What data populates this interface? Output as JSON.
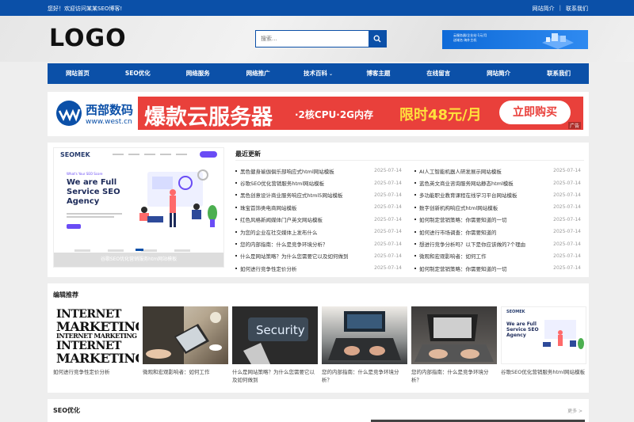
{
  "topbar": {
    "welcome": "您好！欢迎访问某某SEO博客!",
    "links": [
      "网站简介",
      "联系我们"
    ],
    "separator": "|"
  },
  "header": {
    "logo": "LOGO",
    "search_placeholder": "搜索...",
    "banner_lines": [
      "云服务器/企业站·1元/月",
      "送域名·海外主机"
    ]
  },
  "nav": {
    "items": [
      "网站首页",
      "SEO优化",
      "网络服务",
      "网络推广",
      "技术百科",
      "博客主题",
      "在线留言",
      "网站简介",
      "联系我们"
    ],
    "dropdown_arrow": "⌄"
  },
  "ad": {
    "brand_name": "西部数码",
    "brand_site": "www.west.cn",
    "headline": "爆款云服务器",
    "spec": "·2核CPU·2G内存",
    "price": "限时48元/月",
    "cta": "立即购买",
    "tag": "广告"
  },
  "latest": {
    "title": "最近更新",
    "showcase": {
      "logo": "SEOMEK",
      "kicker": "What's Your SEO Score",
      "headline": "We are Full Service SEO Agency",
      "caption": "谷歌SEO优化营销服务htm网站模板"
    },
    "left": [
      {
        "title": "黑色健身瑜伽俱乐部响应式html网站模板",
        "date": "2025-07-14"
      },
      {
        "title": "谷歌SEO优化营销服务html网站模板",
        "date": "2025-07-14"
      },
      {
        "title": "黑色创意设计商业服务响应式html5网站模板",
        "date": "2025-07-14"
      },
      {
        "title": "珠宝首饰类电商网站模板",
        "date": "2025-07-14"
      },
      {
        "title": "红色风格新闻媒体门户英文网站模板",
        "date": "2025-07-14"
      },
      {
        "title": "为您的企业在社交媒体上发布什么",
        "date": "2025-07-14"
      },
      {
        "title": "您的内部指南：什么是竞争环境分析？",
        "date": "2025-07-14"
      },
      {
        "title": "什么是网站策略？为什么您需要它以及如何做到",
        "date": "2025-07-14"
      },
      {
        "title": "如何进行竞争性定价分析",
        "date": "2025-07-14"
      }
    ],
    "right": [
      {
        "title": "AI人工智能机器人研发展示网站模板",
        "date": "2025-07-14"
      },
      {
        "title": "蓝色英文商业咨询服务网站静态html模板",
        "date": "2025-07-14"
      },
      {
        "title": "多功能职业教育课程在线学习平台网站模板",
        "date": "2025-07-14"
      },
      {
        "title": "数字创新机构响应式html网站模板",
        "date": "2025-07-14"
      },
      {
        "title": "如何制定营销策略：你需要知道的一切",
        "date": "2025-07-14"
      },
      {
        "title": "如何进行市场调查：你需要知道的",
        "date": "2025-07-14"
      },
      {
        "title": "想进行竞争分析吗？以下是你应该做的7个理由",
        "date": "2025-07-14"
      },
      {
        "title": "微观和宏观影响者：如何工作",
        "date": "2025-07-14"
      },
      {
        "title": "如何制定营销策略：你需要知道的一切",
        "date": "2025-07-14"
      }
    ]
  },
  "recommend": {
    "title": "编辑推荐",
    "image1_words": [
      "INTERNET",
      "MARKETING",
      "INTERNET MARKETING",
      "INTERNET",
      "MARKETING"
    ],
    "image3_word": "Security",
    "cards": [
      {
        "caption": "如何进行竞争性定价分析"
      },
      {
        "caption": "微观和宏观影响者：如何工作"
      },
      {
        "caption": "什么是网站策略？为什么您需要它以及如何做到"
      },
      {
        "caption": "您的内部指南：什么是竞争环境分析？"
      },
      {
        "caption": "您的内部指南：什么是竞争环境分析？"
      },
      {
        "caption": "谷歌SEO优化营销服务html网站模板"
      }
    ]
  },
  "seo": {
    "title": "SEO优化",
    "more": "更多 >"
  },
  "colors": {
    "primary": "#0b50a8",
    "ad_red": "#e9403b",
    "ad_price": "#ffe13c"
  }
}
